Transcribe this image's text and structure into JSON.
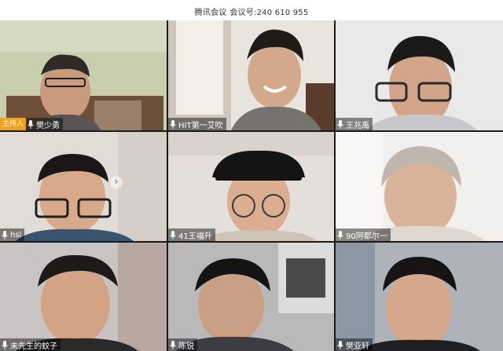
{
  "header": {
    "app_name": "腾讯会议",
    "meeting_id_label": "会议号:",
    "meeting_id": "240 610 955"
  },
  "participants": [
    {
      "name": "樊少勇",
      "host_badge": "主持人",
      "mic": "on"
    },
    {
      "name": "HIT第一艾吹",
      "mic": "on"
    },
    {
      "name": "王兆禹",
      "mic": "on"
    },
    {
      "name": "hsl",
      "mic": "on"
    },
    {
      "name": "41王福升",
      "mic": "on"
    },
    {
      "name": "90阿都尔一",
      "mic": "on"
    },
    {
      "name": "未先生的蚊子",
      "mic": "on"
    },
    {
      "name": "陈锐",
      "mic": "on"
    },
    {
      "name": "樊亚轩",
      "mic": "on"
    }
  ],
  "controls": {
    "next_page_glyph": "›"
  },
  "colors": {
    "host_badge": "#f0a020",
    "active_border": "#3a8ee6",
    "mic": "#ffffff"
  }
}
